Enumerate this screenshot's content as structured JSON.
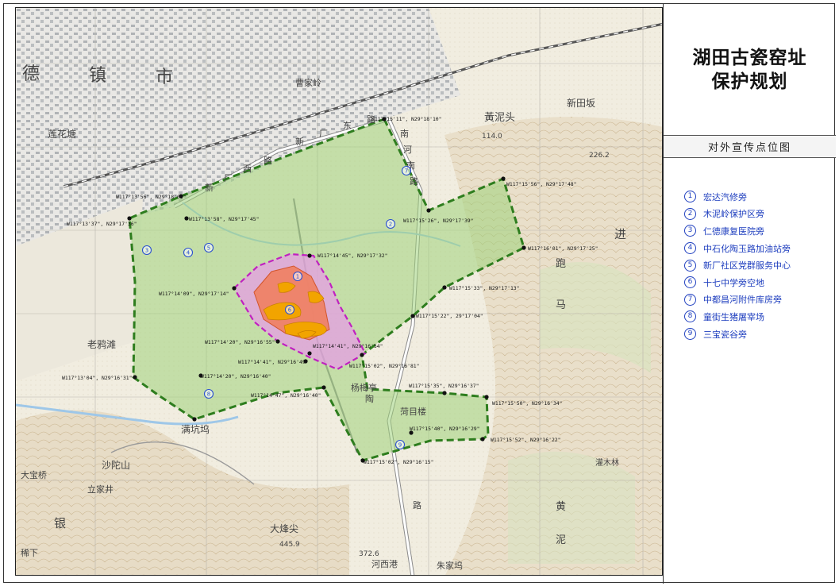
{
  "title": {
    "line1": "湖田古瓷窑址",
    "line2": "保护规划"
  },
  "subtitle": "对外宣传点位图",
  "legend": [
    {
      "num": "1",
      "label": "宏达汽修旁"
    },
    {
      "num": "2",
      "label": "木泥岭保护区旁"
    },
    {
      "num": "3",
      "label": "仁德康复医院旁"
    },
    {
      "num": "4",
      "label": "中石化陶玉路加油站旁"
    },
    {
      "num": "5",
      "label": "新厂社区党群服务中心"
    },
    {
      "num": "6",
      "label": "十七中学旁空地"
    },
    {
      "num": "7",
      "label": "中都昌河附件库房旁"
    },
    {
      "num": "8",
      "label": "童街生猪屠宰场"
    },
    {
      "num": "9",
      "label": "三宝瓷谷旁"
    }
  ],
  "colors": {
    "boundary_green": "#2e7d1e",
    "zone_green": "#9fd27a",
    "control_pink": "#e07be0",
    "core_red": "#f08060",
    "kiln_orange": "#f2a400",
    "marker_blue": "#2a4fd0"
  },
  "map": {
    "coordinates": [
      "W117°15'11\", N29°18'10\"",
      "W117°13'56\", N29°18'01\"",
      "W117°13'37\", N29°17'36\"",
      "W117°13'58\", N29°17'45\"",
      "W117°15'26\", N29°17'39\"",
      "W117°15'56\", N29°17'48\"",
      "W117°16'01\", N29°17'25\"",
      "W117°14'45\", N29°17'32\"",
      "W117°14'09\", N29°17'14\"",
      "W117°15'33\", N29°17'13\"",
      "W117°15'22\", 29°17'04\"",
      "W117°14'20\", N29°16'55\"",
      "W117°14'41\", N29°16'54\"",
      "W117°14'41\", N29°16'49\"",
      "W117°15'02\", N29°16'81\"",
      "W117°13'04\", N29°16'31\"",
      "W117°14'20\", N29°16'40\"",
      "W117°14'47\", N29°16'40\"",
      "W117°15'35\", N29°16'37\"",
      "W117°15'50\", N29°16'34\"",
      "W117°15'40\", N29°16'29\"",
      "W117°15'52\", N29°16'22\"",
      "W117°15'02\", N29°16'15\""
    ],
    "place_names": {
      "city": [
        "德",
        "镇",
        "市"
      ],
      "caojialing": "曹家岭",
      "huangnitou": "黃泥头",
      "xintianban": "新田坂",
      "lianhuatang": "莲花塘",
      "laoyawan": "老鸦滩",
      "yangmeiting": "杨梅亭",
      "hemuyang": "菏目楼",
      "mankengwu": "满坑坞",
      "shatuoshan": "沙陀山",
      "dafengjian": "大烽尖",
      "hexigang": "河西港",
      "zhujiawu": "朱家坞",
      "xinchangdonglu": [
        "新",
        "厂",
        "东",
        "路"
      ],
      "xinchangxilu": [
        "新",
        "厂",
        "西",
        "路"
      ],
      "nanhenanlu": [
        "南",
        "河",
        "南",
        "路"
      ],
      "road_lu": "路",
      "tao": "陶",
      "jin": "进",
      "pao": "跑",
      "ma": "马",
      "huang": "黄",
      "ni": "泥",
      "yin": "银",
      "guanmulin": "灌木林",
      "dabaoqiao": "大宝桥",
      "lishi": "立家井",
      "gaotiange": "稀下",
      "elevation1": "226.2",
      "elevation2": "445.9",
      "elevation3": "372.6",
      "elevation4": "114.0"
    },
    "markers": [
      "1",
      "2",
      "3",
      "4",
      "5",
      "6",
      "7",
      "8",
      "9"
    ]
  }
}
